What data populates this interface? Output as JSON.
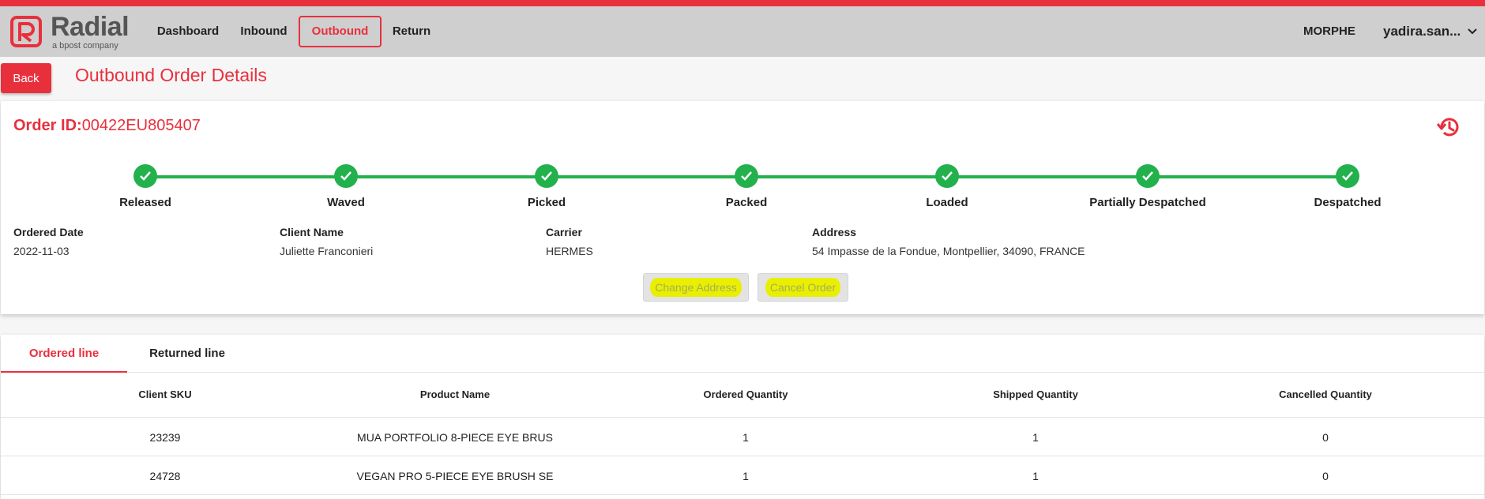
{
  "brand": {
    "name": "Radial",
    "tagline": "a bpost company",
    "accent_color": "#e8303d",
    "success_color": "#22b14c"
  },
  "nav": {
    "items": [
      {
        "label": "Dashboard"
      },
      {
        "label": "Inbound"
      },
      {
        "label": "Outbound",
        "active": true
      },
      {
        "label": "Return"
      }
    ],
    "org": "MORPHE",
    "user": "yadira.san..."
  },
  "page": {
    "back_label": "Back",
    "title": "Outbound Order Details"
  },
  "order": {
    "id_label": "Order ID:",
    "id_value": "00422EU805407",
    "steps": [
      "Released",
      "Waved",
      "Picked",
      "Packed",
      "Loaded",
      "Partially Despatched",
      "Despatched"
    ],
    "fields": [
      {
        "label": "Ordered Date",
        "value": "2022-11-03"
      },
      {
        "label": "Client Name",
        "value": "Juliette Franconieri"
      },
      {
        "label": "Carrier",
        "value": "HERMES"
      },
      {
        "label": "Address",
        "value": "54 Impasse de la Fondue, Montpellier, 34090, FRANCE"
      }
    ],
    "actions": {
      "change_address": "Change Address",
      "cancel_order": "Cancel Order"
    }
  },
  "tabs": [
    {
      "label": "Ordered line",
      "active": true
    },
    {
      "label": "Returned line"
    }
  ],
  "table": {
    "columns": [
      "Client SKU",
      "Product Name",
      "Ordered Quantity",
      "Shipped Quantity",
      "Cancelled Quantity"
    ],
    "rows": [
      [
        "23239",
        "MUA PORTFOLIO 8-PIECE EYE BRUS",
        "1",
        "1",
        "0"
      ],
      [
        "24728",
        "VEGAN PRO 5-PIECE EYE BRUSH SE",
        "1",
        "1",
        "0"
      ]
    ]
  }
}
